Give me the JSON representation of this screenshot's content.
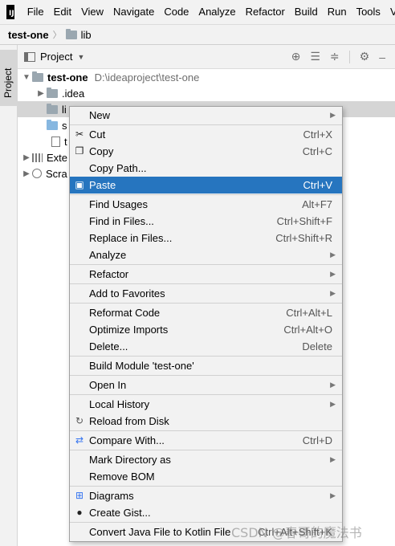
{
  "menubar": {
    "logo_text": "IJ",
    "items": [
      "File",
      "Edit",
      "View",
      "Navigate",
      "Code",
      "Analyze",
      "Refactor",
      "Build",
      "Run",
      "Tools",
      "V"
    ]
  },
  "navbar": {
    "project": "test-one",
    "folder": "lib"
  },
  "sidebar": {
    "tab_label": "Project"
  },
  "panel": {
    "title": "Project",
    "icons": [
      "crosshair-icon",
      "expand-all-icon",
      "collapse-all-icon",
      "gear-icon",
      "hide-icon"
    ]
  },
  "tree": {
    "root_name": "test-one",
    "root_path": "D:\\ideaproject\\test-one",
    "rows": [
      ".idea",
      "li",
      "s",
      "t",
      "Exte",
      "Scra"
    ]
  },
  "context_menu": {
    "items": [
      {
        "label": "New",
        "shortcut": "",
        "submenu": true,
        "icon": ""
      },
      {
        "sep": true
      },
      {
        "label": "Cut",
        "shortcut": "Ctrl+X",
        "icon": "scissors-icon"
      },
      {
        "label": "Copy",
        "shortcut": "Ctrl+C",
        "icon": "copy-icon"
      },
      {
        "label": "Copy Path...",
        "shortcut": ""
      },
      {
        "label": "Paste",
        "shortcut": "Ctrl+V",
        "icon": "paste-icon",
        "active": true
      },
      {
        "sep": true
      },
      {
        "label": "Find Usages",
        "shortcut": "Alt+F7"
      },
      {
        "label": "Find in Files...",
        "shortcut": "Ctrl+Shift+F"
      },
      {
        "label": "Replace in Files...",
        "shortcut": "Ctrl+Shift+R"
      },
      {
        "label": "Analyze",
        "shortcut": "",
        "submenu": true
      },
      {
        "sep": true
      },
      {
        "label": "Refactor",
        "shortcut": "",
        "submenu": true
      },
      {
        "sep": true
      },
      {
        "label": "Add to Favorites",
        "shortcut": "",
        "submenu": true
      },
      {
        "sep": true
      },
      {
        "label": "Reformat Code",
        "shortcut": "Ctrl+Alt+L"
      },
      {
        "label": "Optimize Imports",
        "shortcut": "Ctrl+Alt+O"
      },
      {
        "label": "Delete...",
        "shortcut": "Delete"
      },
      {
        "sep": true
      },
      {
        "label": "Build Module 'test-one'",
        "shortcut": ""
      },
      {
        "sep": true
      },
      {
        "label": "Open In",
        "shortcut": "",
        "submenu": true
      },
      {
        "sep": true
      },
      {
        "label": "Local History",
        "shortcut": "",
        "submenu": true
      },
      {
        "label": "Reload from Disk",
        "shortcut": "",
        "icon": "reload-icon"
      },
      {
        "sep": true
      },
      {
        "label": "Compare With...",
        "shortcut": "Ctrl+D",
        "icon": "compare-icon"
      },
      {
        "sep": true
      },
      {
        "label": "Mark Directory as",
        "shortcut": "",
        "submenu": true
      },
      {
        "label": "Remove BOM",
        "shortcut": ""
      },
      {
        "sep": true
      },
      {
        "label": "Diagrams",
        "shortcut": "",
        "submenu": true,
        "icon": "diagram-icon"
      },
      {
        "label": "Create Gist...",
        "shortcut": "",
        "icon": "github-icon"
      },
      {
        "sep": true
      },
      {
        "label": "Convert Java File to Kotlin File",
        "shortcut": "Ctrl+Alt+Shift+K"
      }
    ]
  },
  "watermark": "CSDN @春哥的魔法书",
  "colors": {
    "menu_bg": "#f2f2f2",
    "selection": "#2675bf",
    "tree_selected": "#d5d5d5"
  }
}
